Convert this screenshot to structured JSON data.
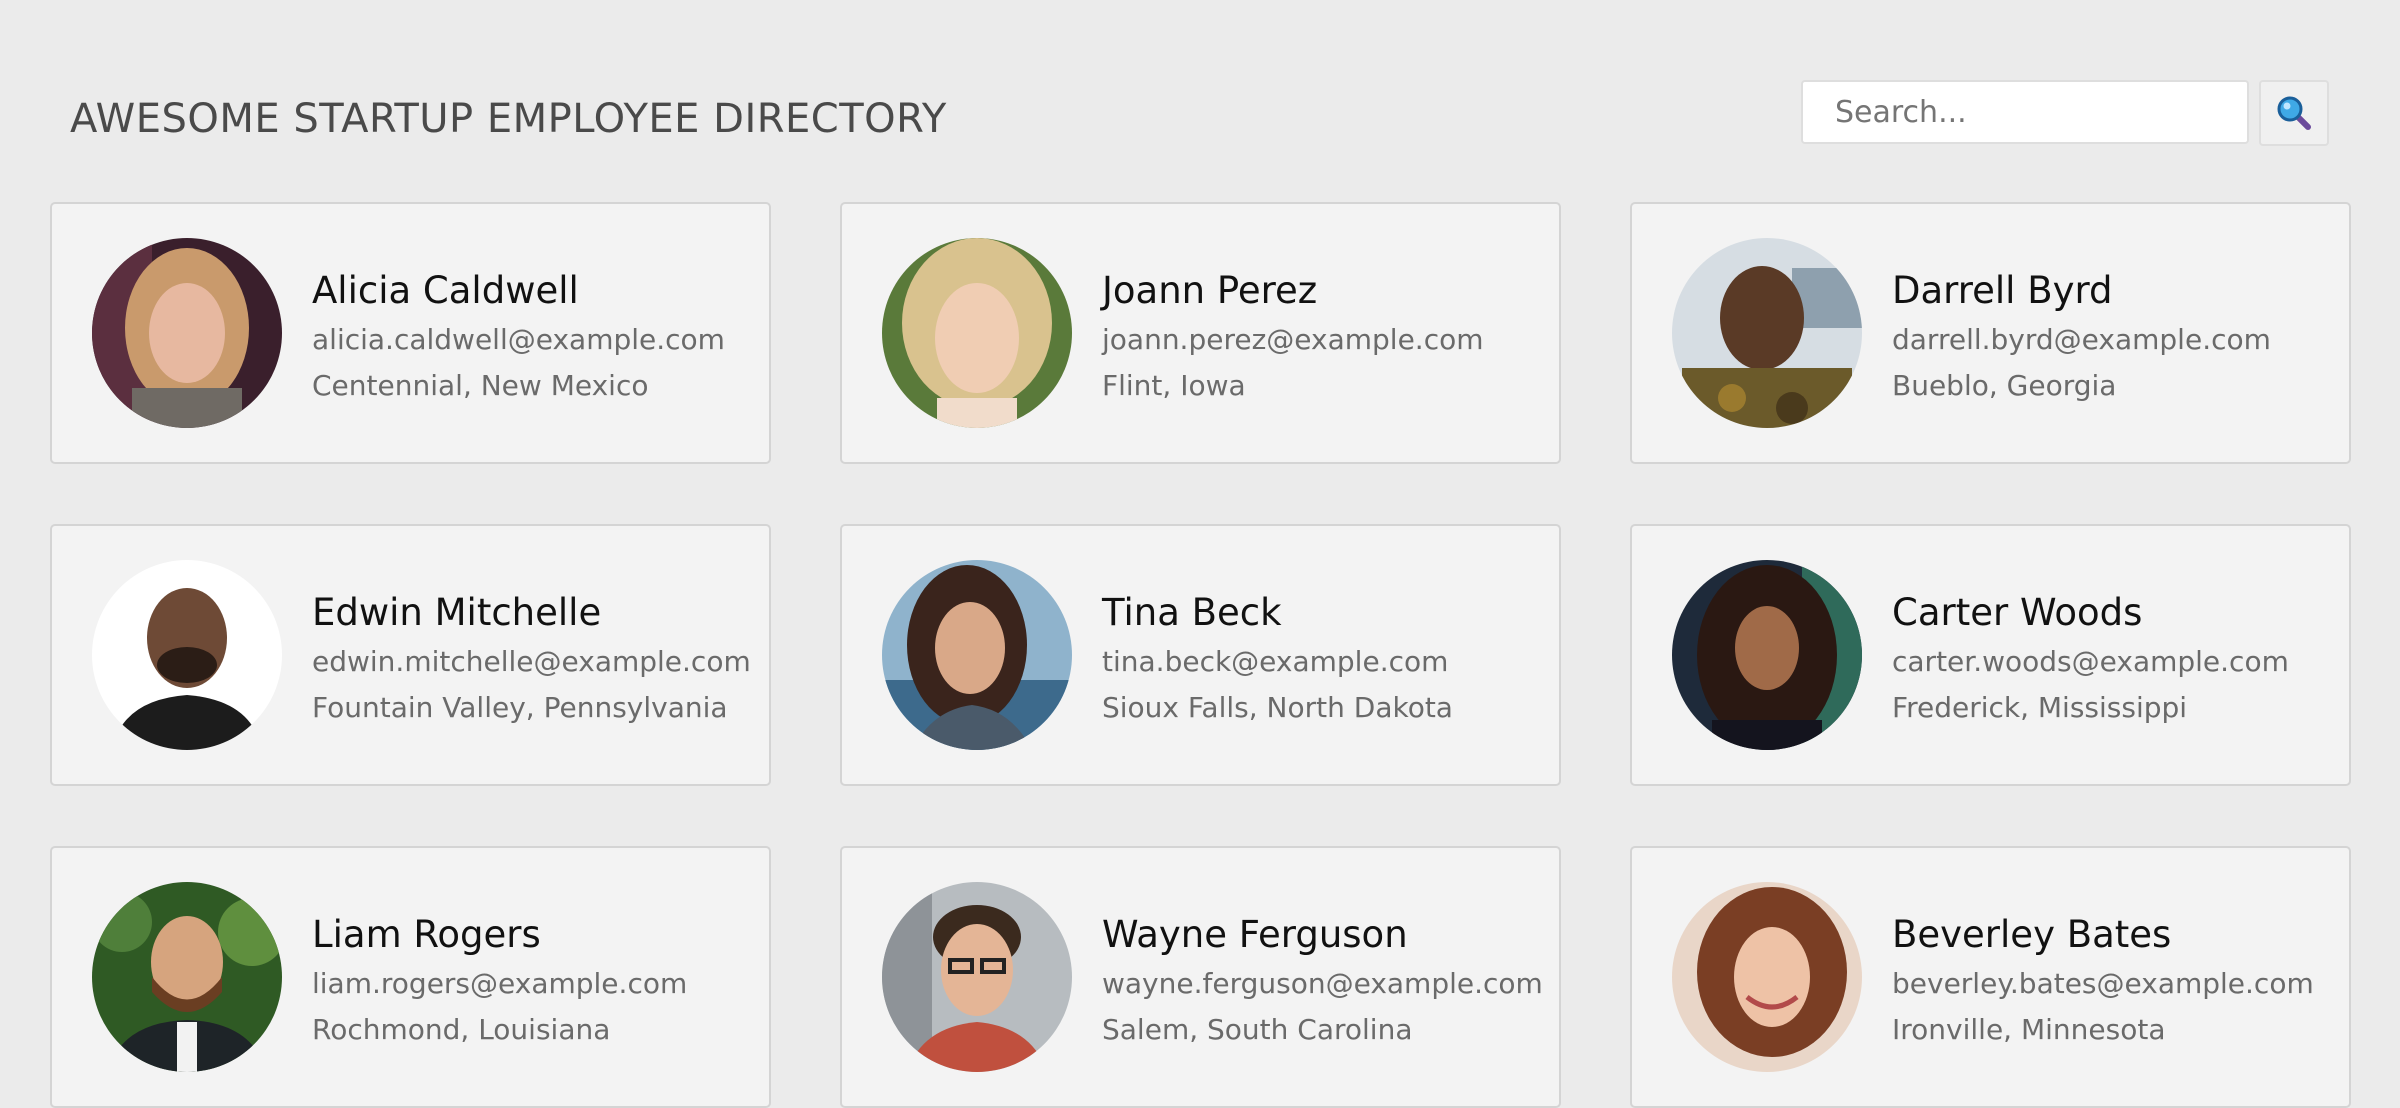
{
  "header": {
    "title": "AWESOME STARTUP EMPLOYEE DIRECTORY"
  },
  "search": {
    "placeholder": "Search...",
    "value": "",
    "button_icon": "search-icon"
  },
  "employees": [
    {
      "name": "Alicia Caldwell",
      "email": "alicia.caldwell@example.com",
      "location": "Centennial, New Mexico"
    },
    {
      "name": "Joann Perez",
      "email": "joann.perez@example.com",
      "location": "Flint, Iowa"
    },
    {
      "name": "Darrell Byrd",
      "email": "darrell.byrd@example.com",
      "location": "Bueblo, Georgia"
    },
    {
      "name": "Edwin Mitchelle",
      "email": "edwin.mitchelle@example.com",
      "location": "Fountain Valley, Pennsylvania"
    },
    {
      "name": "Tina Beck",
      "email": "tina.beck@example.com",
      "location": "Sioux Falls, North Dakota"
    },
    {
      "name": "Carter Woods",
      "email": "carter.woods@example.com",
      "location": "Frederick, Mississippi"
    },
    {
      "name": "Liam Rogers",
      "email": "liam.rogers@example.com",
      "location": "Rochmond, Louisiana"
    },
    {
      "name": "Wayne Ferguson",
      "email": "wayne.ferguson@example.com",
      "location": "Salem, South Carolina"
    },
    {
      "name": "Beverley Bates",
      "email": "beverley.bates@example.com",
      "location": "Ironville, Minnesota"
    }
  ]
}
